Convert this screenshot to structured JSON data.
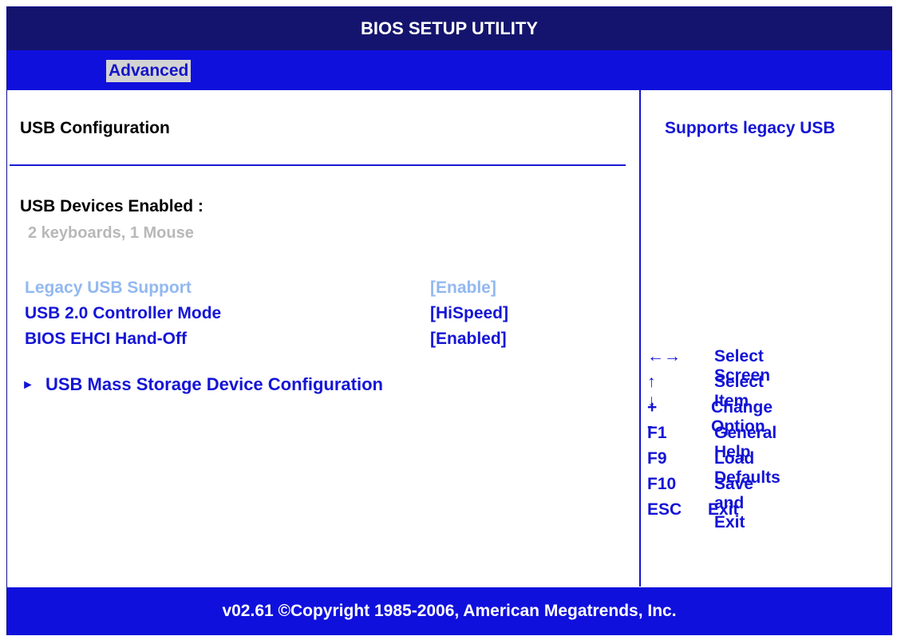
{
  "window": {
    "title": "BIOS SETUP UTILITY"
  },
  "menu": {
    "tabs": [
      {
        "label": "Advanced",
        "selected": true
      }
    ]
  },
  "main": {
    "section_title": "USB Configuration",
    "devices_label": "USB Devices Enabled :",
    "devices_value": "2 keyboards, 1 Mouse",
    "settings": [
      {
        "label": "Legacy USB Support",
        "value": "[Enable]",
        "selected": true
      },
      {
        "label": "USB 2.0 Controller Mode",
        "value": "[HiSpeed]",
        "selected": false
      },
      {
        "label": "BIOS EHCI Hand-Off",
        "value": "[Enabled]",
        "selected": false
      }
    ],
    "submenu": {
      "arrow": "►",
      "label": "USB Mass Storage Device Configuration"
    }
  },
  "help": {
    "text": "Supports legacy USB",
    "keys": [
      {
        "key": "←→",
        "desc": "Select Screen"
      },
      {
        "key": "↑ ↓",
        "desc": "Select Item"
      },
      {
        "key": "+ -",
        "desc": "Change Option"
      },
      {
        "key": "F1",
        "desc": "General Help"
      },
      {
        "key": "F9",
        "desc": "Load Defaults"
      },
      {
        "key": "F10",
        "desc": "Save and Exit"
      },
      {
        "key": "ESC",
        "desc": "Exit"
      }
    ]
  },
  "footer": {
    "text": "v02.61 ©Copyright 1985-2006, American Megatrends, Inc."
  },
  "colors": {
    "title_bar": "#14146e",
    "menu_bar": "#1010dd",
    "text_blue": "#1414d6",
    "highlight": "#92b8f0",
    "disabled": "#b8b8b8"
  }
}
